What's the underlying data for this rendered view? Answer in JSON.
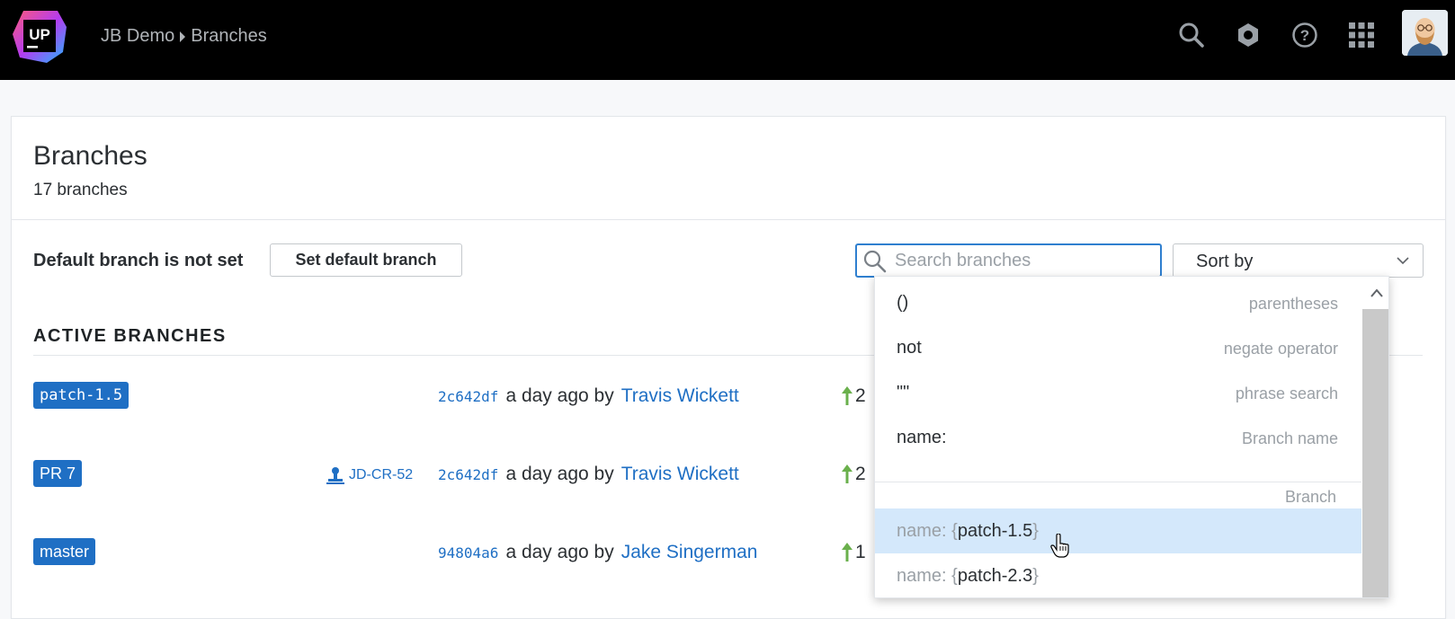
{
  "header": {
    "logo_text": "UP",
    "breadcrumb": {
      "project": "JB Demo",
      "page": "Branches"
    },
    "icons": [
      "search-icon",
      "settings-icon",
      "help-icon",
      "apps-grid-icon"
    ],
    "avatar": "user-avatar"
  },
  "page": {
    "title": "Branches",
    "count_text": "17 branches",
    "default_branch_text": "Default branch is not set",
    "set_default_label": "Set default branch",
    "search_placeholder": "Search branches",
    "sort_label": "Sort by",
    "section_title": "ACTIVE BRANCHES"
  },
  "branches": [
    {
      "name": "patch-1.5",
      "review": "",
      "hash": "2c642df",
      "when": "a day ago by",
      "author": "Travis Wickett",
      "ahead": "2"
    },
    {
      "name": "PR 7",
      "review": "JD-CR-52",
      "hash": "2c642df",
      "when": "a day ago by",
      "author": "Travis Wickett",
      "ahead": "2"
    },
    {
      "name": "master",
      "review": "",
      "hash": "94804a6",
      "when": "a day ago by",
      "author": "Jake Singerman",
      "ahead": "1"
    }
  ],
  "dropdown": {
    "operators": [
      {
        "key": "()",
        "desc": "parentheses"
      },
      {
        "key": "not",
        "desc": "negate operator"
      },
      {
        "key": "\"\"",
        "desc": "phrase search"
      },
      {
        "key": "name:",
        "desc": "Branch name"
      }
    ],
    "group_label": "Branch",
    "values": [
      {
        "prefix": "name: {",
        "value": "patch-1.5",
        "suffix": "}",
        "highlighted": true
      },
      {
        "prefix": "name: {",
        "value": "patch-2.3",
        "suffix": "}",
        "highlighted": false
      }
    ]
  },
  "colors": {
    "accent": "#1f6fc4",
    "highlight": "#d4e8fb",
    "ahead_arrow": "#6ab04c"
  }
}
